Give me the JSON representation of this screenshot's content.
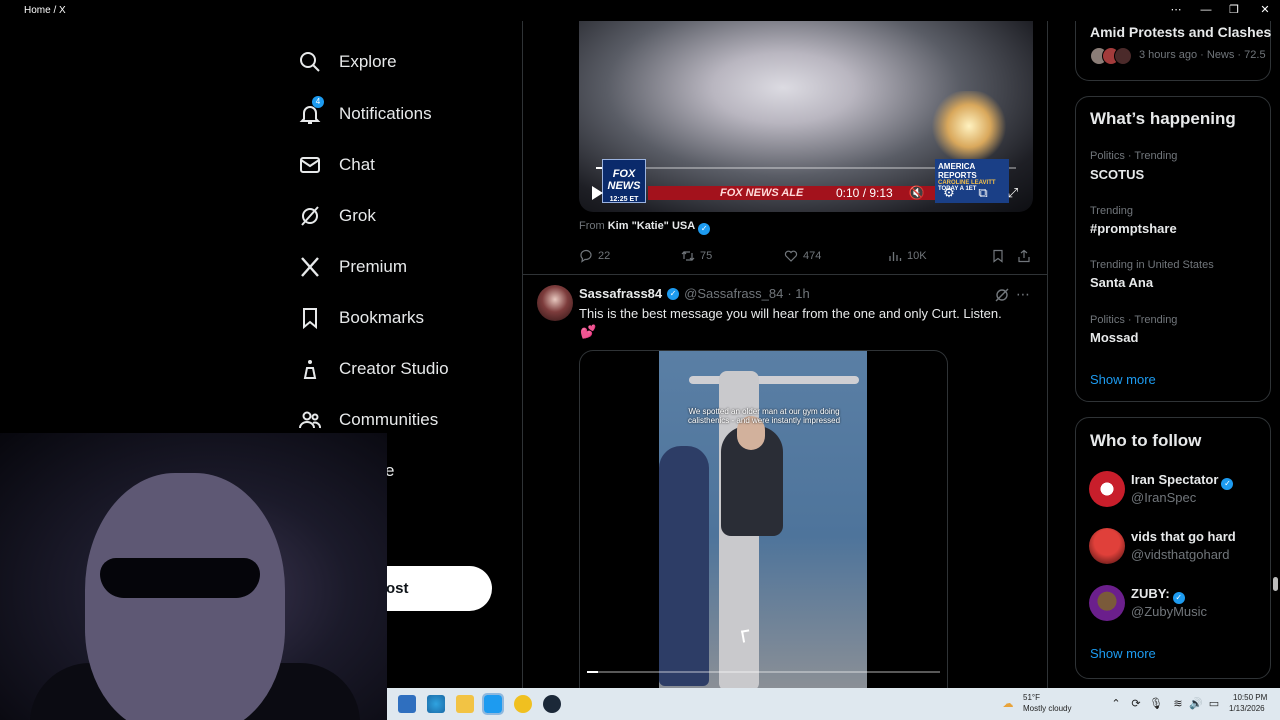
{
  "window": {
    "tab_title": "Home / X",
    "controls": [
      "⋯",
      "—",
      "❐",
      "✕"
    ]
  },
  "nav": {
    "items": [
      {
        "label": "Explore",
        "icon": "search-icon"
      },
      {
        "label": "Notifications",
        "icon": "bell-icon",
        "badge": "4"
      },
      {
        "label": "Chat",
        "icon": "mail-icon"
      },
      {
        "label": "Grok",
        "icon": "grok-icon"
      },
      {
        "label": "Premium",
        "icon": "x-logo-icon"
      },
      {
        "label": "Bookmarks",
        "icon": "bookmark-icon"
      },
      {
        "label": "Creator Studio",
        "icon": "flask-icon"
      },
      {
        "label": "Communities",
        "icon": "people-icon"
      }
    ],
    "partial_item_label": "e",
    "post_button_label": "ost"
  },
  "post1": {
    "video": {
      "time": "0:10 / 9:13",
      "ticker_text": "FOX NEWS ALE",
      "logo_text": "FOX NEWS",
      "logo_time": "12:25 ET",
      "report_text": "AMERICA REPORTS",
      "report_subtext": "CAROLINE LEAVITT",
      "report_subtext2": "TODAY A 1ET",
      "progress": 0.02
    },
    "from_label": "From",
    "from_name": "Kim \"Katie\" USA",
    "replies": "22",
    "reposts": "75",
    "likes": "474",
    "views": "10K"
  },
  "post2": {
    "name": "Sassafrass84",
    "handle": "@Sassafrass_84",
    "time": "· 1h",
    "text": "This is the best message you will hear from the one and only Curt. Listen.",
    "emoji": "💕",
    "video_caption": "We spotted an older man at our gym doing calisthenics - and were instantly impressed",
    "video_progress": 0.03
  },
  "right": {
    "top_trend": {
      "headline": "Amid Protests and Clashes",
      "meta": "3 hours ago · News · 72.5"
    },
    "whats_happening": {
      "title": "What’s happening",
      "trends": [
        {
          "category": "Politics · Trending",
          "name": "SCOTUS"
        },
        {
          "category": "Trending",
          "name": "#promptshare"
        },
        {
          "category": "Trending in United States",
          "name": "Santa Ana"
        },
        {
          "category": "Politics · Trending",
          "name": "Mossad"
        }
      ],
      "show_more": "Show more"
    },
    "who_to_follow": {
      "title": "Who to follow",
      "accounts": [
        {
          "name": "Iran Spectator",
          "handle": "@IranSpec",
          "verified": true
        },
        {
          "name": "vids that go hard",
          "handle": "@vidsthatgohard",
          "verified": false
        },
        {
          "name": "ZUBY:",
          "handle": "@ZubyMusic",
          "verified": true
        }
      ],
      "show_more": "Show more"
    }
  },
  "taskbar": {
    "weather_temp": "51°F",
    "weather_desc": "Mostly cloudy",
    "time": "10:50 PM",
    "date": "1/13/2026"
  },
  "colors": {
    "accent": "#1d9bf0",
    "text": "#e7e9ea",
    "muted": "#71767b",
    "border": "#2f3336",
    "background": "#000000"
  }
}
